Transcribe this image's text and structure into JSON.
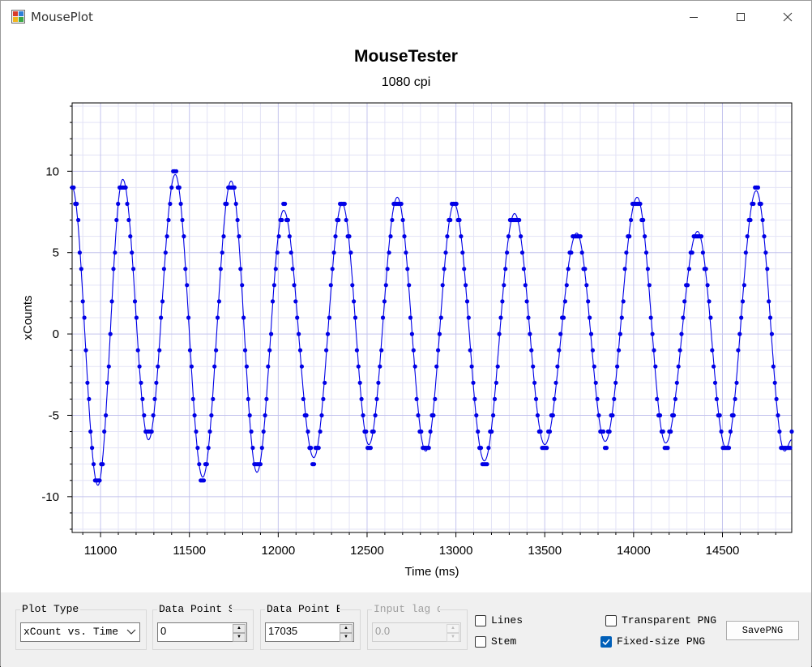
{
  "window": {
    "title": "MousePlot"
  },
  "chart_data": {
    "type": "line",
    "title": "MouseTester",
    "subtitle": "1080 cpi",
    "xlabel": "Time (ms)",
    "ylabel": "xCounts",
    "xlim": [
      10840,
      14890
    ],
    "ylim": [
      -12.2,
      14.2
    ],
    "x_ticks": [
      11000,
      11500,
      12000,
      12500,
      13000,
      13500,
      14000,
      14500
    ],
    "y_ticks": [
      -10,
      -5,
      0,
      5,
      10
    ],
    "grid": true,
    "series": [
      {
        "color": "#0000e6",
        "peaks": [
          [
            10840,
            9
          ],
          [
            10985,
            -9.3
          ],
          [
            11125,
            9.5
          ],
          [
            11270,
            -6.5
          ],
          [
            11420,
            9.8
          ],
          [
            11575,
            -8.8
          ],
          [
            11735,
            9.4
          ],
          [
            11880,
            -8.5
          ],
          [
            12030,
            7.6
          ],
          [
            12200,
            -7.6
          ],
          [
            12360,
            8
          ],
          [
            12510,
            -6.8
          ],
          [
            12670,
            8.4
          ],
          [
            12830,
            -7.2
          ],
          [
            12990,
            8
          ],
          [
            13160,
            -7.8
          ],
          [
            13330,
            7.4
          ],
          [
            13500,
            -6.8
          ],
          [
            13680,
            6.2
          ],
          [
            13840,
            -6.6
          ],
          [
            14020,
            8.4
          ],
          [
            14180,
            -6.7
          ],
          [
            14360,
            6.3
          ],
          [
            14520,
            -7
          ],
          [
            14690,
            8.8
          ],
          [
            14850,
            -7.2
          ],
          [
            14890,
            -6.5
          ]
        ]
      }
    ]
  },
  "controls": {
    "plot_type": {
      "label": "Plot Type",
      "value": "xCount vs. Time"
    },
    "data_point_start": {
      "label": "Data Point Start",
      "value": "0"
    },
    "data_point_end": {
      "label": "Data Point End",
      "value": "17035"
    },
    "input_lag": {
      "label": "Input lag delay",
      "value": "0.0"
    },
    "lines": {
      "label": "Lines",
      "checked": false
    },
    "stem": {
      "label": "Stem",
      "checked": false
    },
    "transparent_png": {
      "label": "Transparent PNG",
      "checked": false
    },
    "fixed_size_png": {
      "label": "Fixed-size PNG",
      "checked": true
    },
    "save_png": {
      "label": "SavePNG"
    }
  }
}
